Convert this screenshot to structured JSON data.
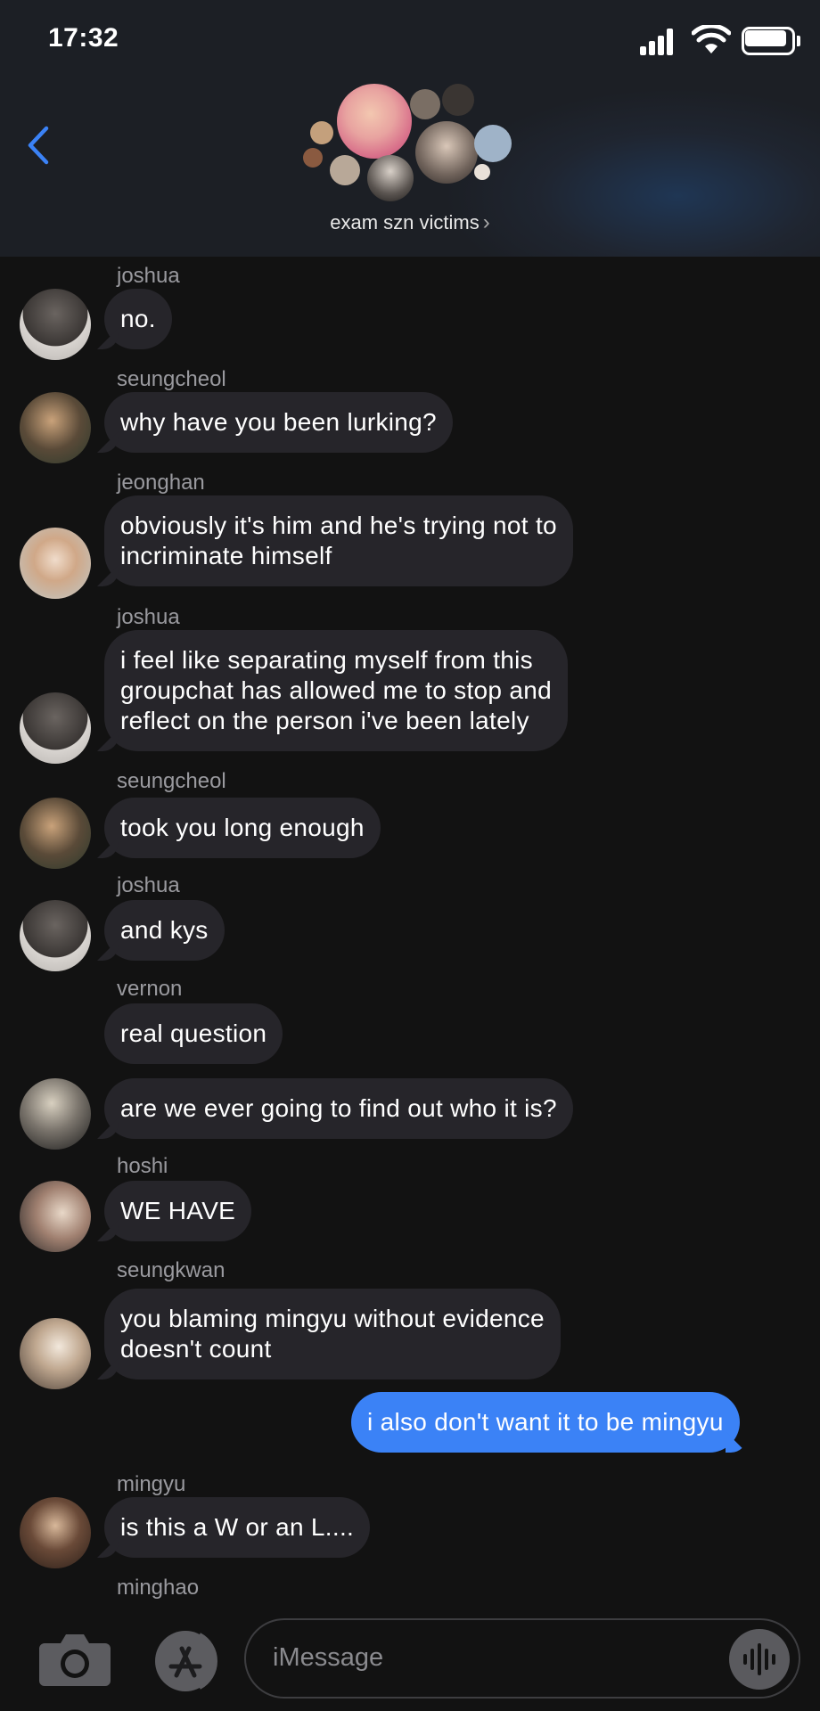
{
  "status_bar": {
    "time": "17:32"
  },
  "header": {
    "back_icon": "chevron-left-icon",
    "group_name": "exam szn victims",
    "chevron": "›"
  },
  "messages": [
    {
      "sender": "joshua",
      "text": "no."
    },
    {
      "sender": "seungcheol",
      "text": "why have you been lurking?"
    },
    {
      "sender": "jeonghan",
      "lines": [
        "obviously it's him and he's trying not to",
        "incriminate himself"
      ]
    },
    {
      "sender": "joshua",
      "lines": [
        "i feel like separating myself from this",
        "groupchat has allowed me to stop and",
        "reflect on the person i've been lately"
      ]
    },
    {
      "sender": "seungcheol",
      "text": "took you long enough"
    },
    {
      "sender": "joshua",
      "text": "and kys"
    },
    {
      "sender": "vernon",
      "text": "real question"
    },
    {
      "sender": "",
      "text": "are we ever going to find out who it is?"
    },
    {
      "sender": "hoshi",
      "text": "WE HAVE"
    },
    {
      "sender": "seungkwan",
      "lines": [
        "you blaming mingyu without evidence",
        "doesn't count"
      ]
    },
    {
      "sender": "me",
      "text": "i also don't want it to be mingyu"
    },
    {
      "sender": "mingyu",
      "text": "is this a W or an L...."
    },
    {
      "sender": "minghao",
      "text": ""
    }
  ],
  "input": {
    "placeholder": "iMessage"
  },
  "colors": {
    "bubble_incoming": "#26252a",
    "bubble_outgoing": "#3b82f6",
    "background": "#121212",
    "sender_label": "#9a9a9f"
  }
}
